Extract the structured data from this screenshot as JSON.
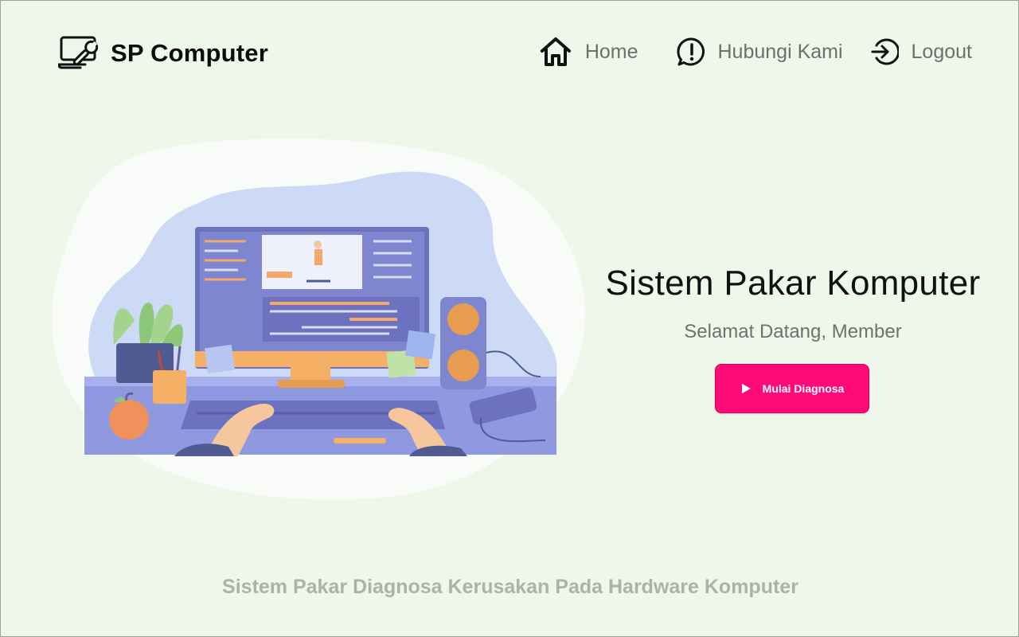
{
  "brand": {
    "name": "SP Computer",
    "icon": "laptop-wrench-icon"
  },
  "nav": {
    "home": {
      "label": "Home",
      "icon": "home-icon"
    },
    "contact": {
      "label": "Hubungi Kami",
      "icon": "alert-chat-icon"
    },
    "logout": {
      "label": "Logout",
      "icon": "logout-icon"
    }
  },
  "hero": {
    "title": "Sistem Pakar Komputer",
    "subtitle": "Selamat Datang, Member",
    "button_label": "Mulai Diagnosa",
    "button_icon": "play-icon",
    "illustration": "person-at-computer-illustration"
  },
  "footer": {
    "text": "Sistem Pakar Diagnosa Kerusakan Pada Hardware Komputer"
  },
  "colors": {
    "background": "#eef7ea",
    "accent": "#ff0a78",
    "footer_text": "#aab3aa"
  }
}
